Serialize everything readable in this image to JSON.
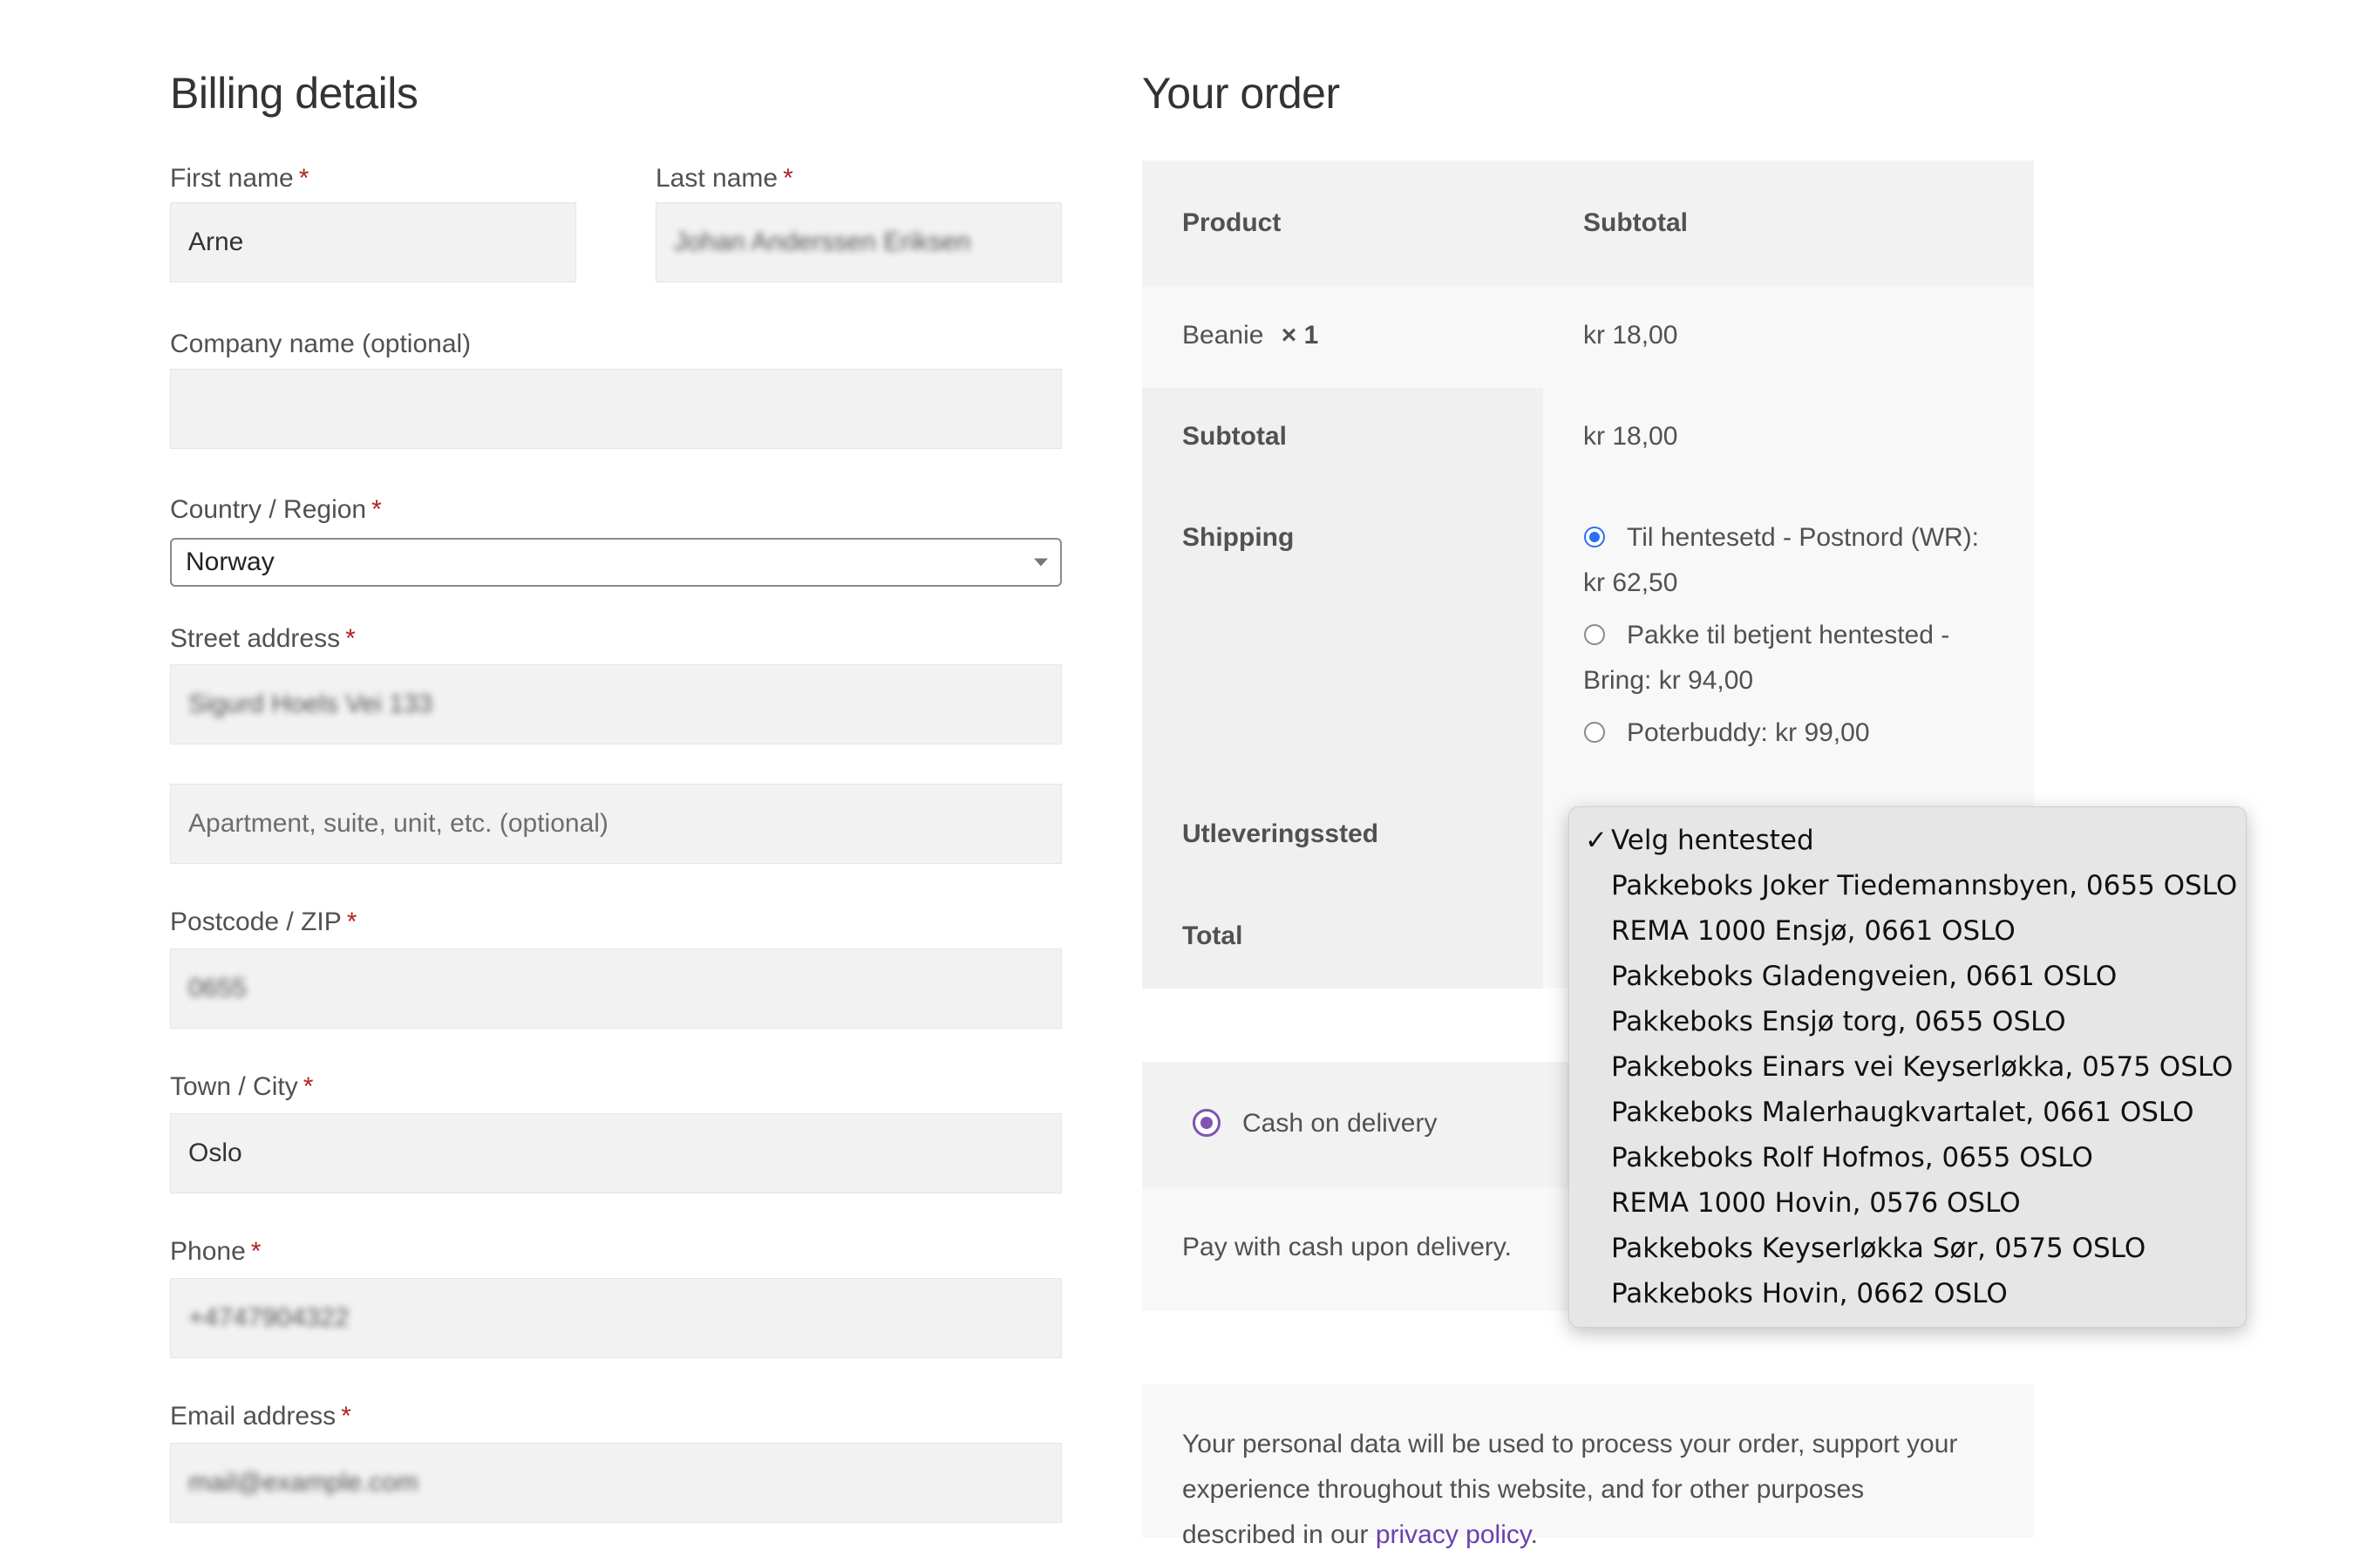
{
  "billing": {
    "title": "Billing details",
    "required_mark": "*",
    "first_name": {
      "label": "First name",
      "value": "Arne"
    },
    "last_name": {
      "label": "Last name",
      "value": "Johan Anderssen Eriksen"
    },
    "company": {
      "label": "Company name (optional)",
      "value": ""
    },
    "country": {
      "label": "Country / Region",
      "value": "Norway"
    },
    "street": {
      "label": "Street address",
      "value": "Sigurd Hoels Vei 133",
      "placeholder2": "Apartment, suite, unit, etc. (optional)"
    },
    "postcode": {
      "label": "Postcode / ZIP",
      "value": "0655"
    },
    "city": {
      "label": "Town / City",
      "value": "Oslo"
    },
    "phone": {
      "label": "Phone",
      "value": "+4747904322"
    },
    "email": {
      "label": "Email address",
      "value": "mail@example.com"
    }
  },
  "order": {
    "title": "Your order",
    "col_product": "Product",
    "col_subtotal": "Subtotal",
    "item_name": "Beanie",
    "item_qty": "× 1",
    "item_price": "kr 18,00",
    "subtotal_label": "Subtotal",
    "subtotal_value": "kr 18,00",
    "shipping_label": "Shipping",
    "shipping_options": [
      {
        "line1": "Til hentesetd - Postnord (WR):",
        "line2": "kr 62,50",
        "selected": true
      },
      {
        "line1": "Pakke til betjent hentested -",
        "line2": "Bring: kr 94,00",
        "selected": false
      },
      {
        "line1": "Poterbuddy: kr 99,00",
        "line2": "",
        "selected": false
      }
    ],
    "pickup_label": "Utleveringssted",
    "total_label": "Total"
  },
  "payment": {
    "method": "Cash on delivery",
    "description": "Pay with cash upon delivery."
  },
  "privacy": {
    "line1": "Your personal data will be used to process your order, support your",
    "line2": "experience throughout this website, and for other purposes",
    "line3_prefix": "described in our",
    "link": "privacy policy",
    "line3_suffix": "."
  },
  "pickup_dropdown": {
    "check": "✓",
    "items": [
      "Velg hentested",
      "Pakkeboks Joker Tiedemannsbyen, 0655 OSLO",
      "REMA 1000 Ensjø, 0661 OSLO",
      "Pakkeboks Gladengveien, 0661 OSLO",
      "Pakkeboks Ensjø torg, 0655 OSLO",
      "Pakkeboks Einars vei Keyserløkka, 0575 OSLO",
      "Pakkeboks Malerhaugkvartalet, 0661 OSLO",
      "Pakkeboks Rolf Hofmos, 0655 OSLO",
      "REMA 1000 Hovin, 0576 OSLO",
      "Pakkeboks Keyserløkka Sør, 0575 OSLO",
      "Pakkeboks Hovin, 0662 OSLO"
    ]
  }
}
